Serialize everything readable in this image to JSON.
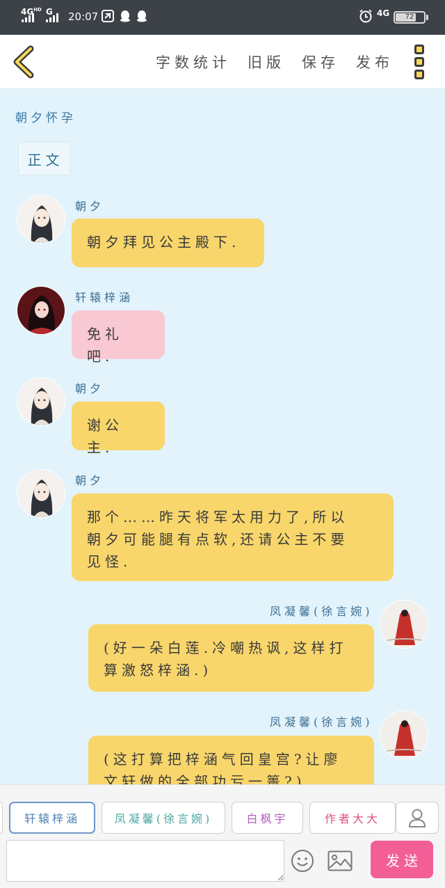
{
  "status_bar": {
    "net1": "4G",
    "net1_sup": "HD",
    "net2": "G",
    "time": "20:07",
    "net3": "4G",
    "battery": "72",
    "battery_level": 0.72
  },
  "toolbar": {
    "word_count": "字数统计",
    "old_version": "旧版",
    "save": "保存",
    "publish": "发布"
  },
  "story": {
    "title": "朝夕怀孕",
    "section": "正文"
  },
  "messages": [
    {
      "name": "朝夕",
      "lines": [
        "朝夕拜见公主殿下."
      ]
    },
    {
      "name": "轩辕梓涵",
      "lines": [
        "免礼吧."
      ]
    },
    {
      "name": "朝夕",
      "lines": [
        "谢公主."
      ]
    },
    {
      "name": "朝夕",
      "lines": [
        "那个……昨天将军太用力了,所以",
        "朝夕可能腿有点软,还请公主不要",
        "见怪."
      ]
    },
    {
      "name": "凤凝馨(徐言婉)",
      "lines": [
        "(好一朵白莲.冷嘲热讽,这样打",
        "算激怒梓涵.)"
      ]
    },
    {
      "name": "凤凝馨(徐言婉)",
      "lines": [
        "(这打算把梓涵气回皇宫?让廖",
        "文轩做的全部功亏一篑?)"
      ]
    }
  ],
  "characters": [
    {
      "label": "轩辕梓涵",
      "color": "#4d7fb3"
    },
    {
      "label": "凤凝馨(徐言婉)",
      "color": "#4aa7a0"
    },
    {
      "label": "白枫宇",
      "color": "#b35fc0"
    },
    {
      "label": "作者大大",
      "color": "#e04f83"
    }
  ],
  "composer": {
    "placeholder": "",
    "send": "发送"
  },
  "icons": {
    "back": "back-chevron-icon",
    "menu": "more-menu-icon",
    "user": "user-icon",
    "emoji": "emoji-icon",
    "image": "image-icon"
  }
}
